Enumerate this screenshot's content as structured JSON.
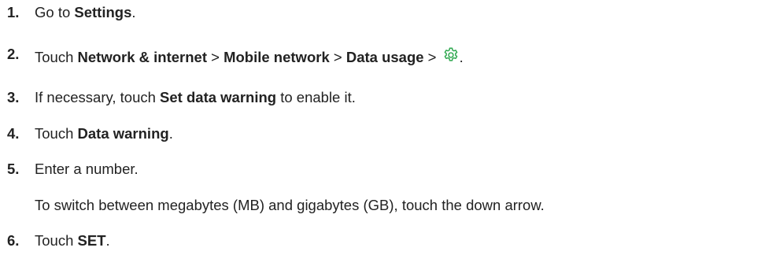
{
  "steps": [
    {
      "number": "1.",
      "parts": [
        "Go to ",
        "Settings",
        "."
      ]
    },
    {
      "number": "2.",
      "parts": [
        "Touch ",
        "Network & internet",
        " > ",
        "Mobile network",
        " > ",
        "Data usage",
        " > ",
        "."
      ],
      "icon": "gear-icon",
      "icon_color": "#2fa84f"
    },
    {
      "number": "3.",
      "parts": [
        "If necessary, touch ",
        "Set data warning",
        " to enable it."
      ]
    },
    {
      "number": "4.",
      "parts": [
        "Touch ",
        "Data warning",
        "."
      ]
    },
    {
      "number": "5.",
      "parts": [
        "Enter a number."
      ],
      "note": "To switch between megabytes (MB) and gigabytes (GB), touch the down arrow."
    },
    {
      "number": "6.",
      "parts": [
        "Touch ",
        "SET",
        "."
      ]
    }
  ]
}
